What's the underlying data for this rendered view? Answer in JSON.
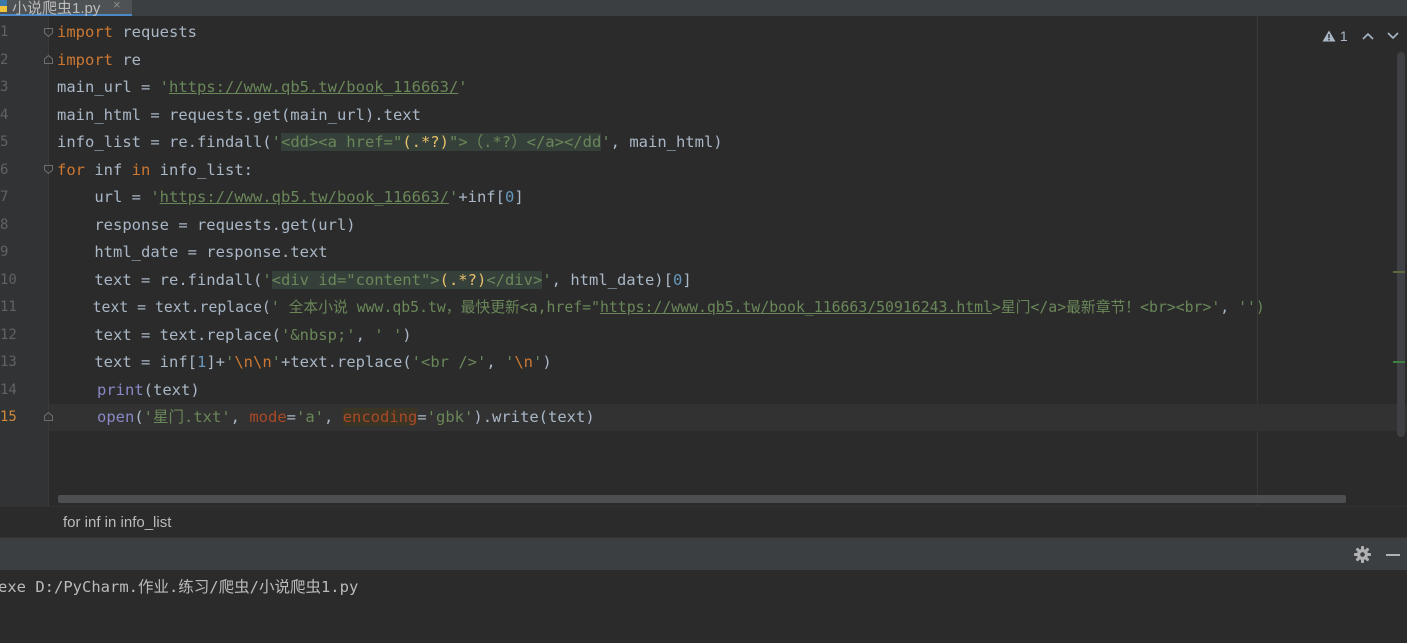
{
  "tab": {
    "filename": "小说爬虫1.py",
    "close_glyph": "×"
  },
  "gutter": {
    "line_numbers": [
      "1",
      "2",
      "3",
      "4",
      "5",
      "6",
      "7",
      "8",
      "9",
      "10",
      "11",
      "12",
      "13",
      "14",
      "15"
    ]
  },
  "inspections": {
    "warning_count": "1"
  },
  "code": {
    "l1": {
      "kw": "import",
      "rest": " requests"
    },
    "l2": {
      "kw": "import",
      "rest": " re"
    },
    "l3": {
      "a": "main_url = ",
      "q1": "'",
      "url": "https://www.qb5.tw/book_116663/",
      "q2": "'"
    },
    "l4": {
      "a": "main_html = requests.get(main_url).text"
    },
    "l5": {
      "a": "info_list = re.findall(",
      "q1": "'",
      "r1": "<dd><a href=\"",
      "g1": "(.*?)",
      "r2": "\">（.*?）</a></dd",
      "q2": "'",
      "b": ", main_html)"
    },
    "l6": {
      "kw1": "for",
      "a": " inf ",
      "kw2": "in",
      "b": " info_list:"
    },
    "l7": {
      "a": "    url = ",
      "q1": "'",
      "url": "https://www.qb5.tw/book_116663/",
      "q2": "'",
      "b": "+inf[",
      "n": "0",
      "c": "]"
    },
    "l8": {
      "a": "    response = requests.get(url)"
    },
    "l9": {
      "a": "    html_date = response.text"
    },
    "l10": {
      "a": "    text = re.findall(",
      "q1": "'",
      "r1": "<div id=\"content\">",
      "g1": "(.*?)",
      "r2": "</div>",
      "q2": "'",
      "b": ", html_date)[",
      "n": "0",
      "c": "]"
    },
    "l11": {
      "a": "    text = text.replace(",
      "s1": "' 全本小说 www.qb5.tw，最快更新<a,href=\"",
      "url": "https://www.qb5.tw/book_116663/50916243.html",
      "s2": ">星门</a>最新章节！<br><br>'",
      "b": ", ",
      "s3": "'')"
    },
    "l12": {
      "a": "    text = text.replace(",
      "s1": "'&nbsp;'",
      "b": ", ",
      "s2": "' '",
      "c": ")"
    },
    "l13": {
      "a": "    text = inf[",
      "n": "1",
      "b": "]+",
      "q1": "'",
      "e1": "\\n\\n",
      "q2": "'",
      "c": "+text.replace(",
      "s1": "'<br />'",
      "d": ", ",
      "q3": "'",
      "e2": "\\n",
      "q4": "'",
      "f": ")"
    },
    "l14": {
      "fn": "print",
      "a": "(text)"
    },
    "l15": {
      "fn": "open",
      "a": "(",
      "s1": "'星门.txt'",
      "b": ", ",
      "p1": "mode",
      "c": "=",
      "s2": "'a'",
      "d": ", ",
      "p2": "encoding",
      "e": "=",
      "s3": "'gbk'",
      "f": ").write(text)"
    }
  },
  "breadcrumb": {
    "text": "for inf in info_list"
  },
  "console": {
    "output": "exe D:/PyCharm.作业.练习/爬虫/小说爬虫1.py"
  },
  "colors": {
    "keyword": "#cc7832",
    "string": "#6a8759",
    "number": "#6897bb",
    "builtin": "#8888c6",
    "param": "#aa4926",
    "background": "#2b2b2b"
  }
}
